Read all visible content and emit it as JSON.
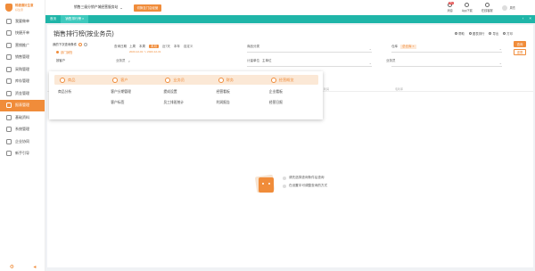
{
  "brand": {
    "name": "畅捷通好生意",
    "sub": "好生意"
  },
  "sidebar": {
    "items": [
      {
        "label": "我要做单",
        "icon": "edit-icon"
      },
      {
        "label": "快捷开单",
        "icon": "bolt-icon"
      },
      {
        "label": "营销推广",
        "icon": "megaphone-icon"
      },
      {
        "label": "销售管理",
        "icon": "cart-icon"
      },
      {
        "label": "采购管理",
        "icon": "truck-icon"
      },
      {
        "label": "库存管理",
        "icon": "box-icon"
      },
      {
        "label": "资金管理",
        "icon": "wallet-icon"
      },
      {
        "label": "报表管理",
        "icon": "chart-icon",
        "active": true
      },
      {
        "label": "基础资料",
        "icon": "folder-icon"
      },
      {
        "label": "系统管理",
        "icon": "gear-icon"
      },
      {
        "label": "企业协同",
        "icon": "people-icon"
      },
      {
        "label": "新手引导",
        "icon": "guide-icon"
      }
    ]
  },
  "topbar": {
    "company": "销售三级分销产城经营服务站",
    "switch_label": "切换至门店经营",
    "items": [
      {
        "label": "消息",
        "badge": "99+"
      },
      {
        "label": "App下载"
      },
      {
        "label": "在线客服"
      }
    ],
    "user": "周杰"
  },
  "tabs": [
    {
      "label": "首页"
    },
    {
      "label": "销售排行榜 ×",
      "active": true
    }
  ],
  "main": {
    "title": "销售排行榜(按业务员)",
    "toolbar": [
      "帮助",
      "图表排行",
      "导出",
      "打印"
    ],
    "side_buttons": {
      "primary": "查询",
      "ghost": "重置"
    },
    "filter_panel": {
      "title": "我的下次查询条件",
      "items": [
        {
          "label": "部门销售",
          "selected": true
        },
        {
          "label": "按客户"
        }
      ]
    },
    "filters": {
      "date_label": "查询日期",
      "date_options": [
        "上周",
        "本周",
        "本月",
        "近7天",
        "本年",
        "自定义"
      ],
      "date_active": "本月",
      "date_from": "2023-12-01",
      "date_to": "2023-12-31",
      "product_label": "商品分类",
      "product_value": "",
      "warehouse_label": "仓库",
      "warehouse_value": "总仓库",
      "salesman_label": "业务员",
      "salesman_value": "",
      "unit_label": "计量单位",
      "unit_value": "主单位",
      "company_label": "业务员",
      "company_value": ""
    },
    "grid_headers": [
      "序号",
      "业务员",
      "金额",
      "数量",
      "利润",
      "毛利率"
    ],
    "empty_state": {
      "line1": "请先选择查询条件后查询",
      "line2": "在设置中可调整查询的方式"
    }
  },
  "popup": {
    "categories": [
      {
        "label": "商品",
        "icon": "product-icon"
      },
      {
        "label": "客户",
        "icon": "customer-icon"
      },
      {
        "label": "业务员",
        "icon": "salesman-icon"
      },
      {
        "label": "财务",
        "icon": "finance-icon"
      },
      {
        "label": "经营概览",
        "icon": "overview-icon"
      }
    ],
    "links": [
      {
        "label": "商品分析",
        "col": 0,
        "row": 0
      },
      {
        "label": "客户分期管理",
        "col": 1,
        "row": 0
      },
      {
        "label": "客户标签",
        "col": 1,
        "row": 1
      },
      {
        "label": "提成设置",
        "col": 2,
        "row": 0
      },
      {
        "label": "员工排班统计",
        "col": 2,
        "row": 1
      },
      {
        "label": "经营看板",
        "col": 3,
        "row": 0
      },
      {
        "label": "利润报告",
        "col": 3,
        "row": 1
      },
      {
        "label": "企业看板",
        "col": 4,
        "row": 0
      },
      {
        "label": "经营日报",
        "col": 4,
        "row": 1
      }
    ]
  },
  "colors": {
    "accent": "#f08c3a",
    "teal": "#1fb5a8"
  }
}
